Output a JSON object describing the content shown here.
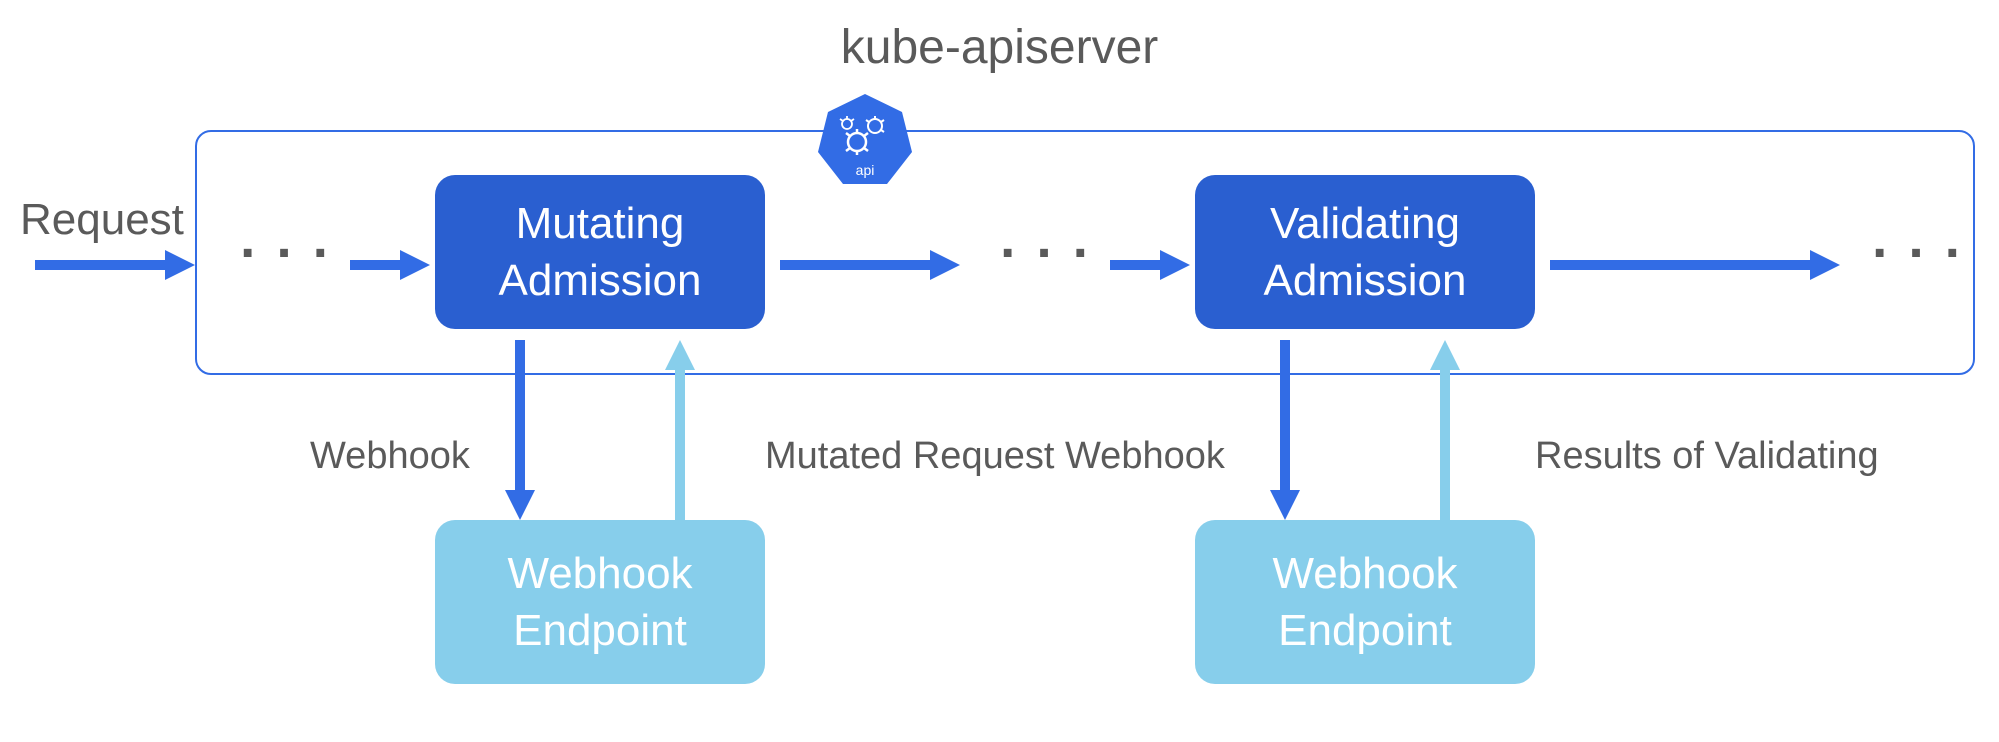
{
  "title": "kube-apiserver",
  "api_badge": "api",
  "request_label": "Request",
  "boxes": {
    "mutating": {
      "line1": "Mutating",
      "line2": "Admission"
    },
    "validating": {
      "line1": "Validating",
      "line2": "Admission"
    },
    "webhook1": {
      "line1": "Webhook",
      "line2": "Endpoint"
    },
    "webhook2": {
      "line1": "Webhook",
      "line2": "Endpoint"
    }
  },
  "labels": {
    "webhook1": "Webhook",
    "mutated": "Mutated Request",
    "webhook2": "Webhook",
    "results": "Results of Validating"
  },
  "colors": {
    "primary_blue": "#326ce5",
    "dark_blue": "#2a5fd0",
    "light_blue": "#87ceeb",
    "text_gray": "#5a5a5a"
  },
  "flow": {
    "description": "Request enters kube-apiserver, passes through Mutating Admission (which calls Webhook Endpoint via Webhook and receives Mutated Request), continues through pipeline, passes through Validating Admission (which calls Webhook Endpoint via Webhook and receives Results of Validating), then continues onward."
  }
}
